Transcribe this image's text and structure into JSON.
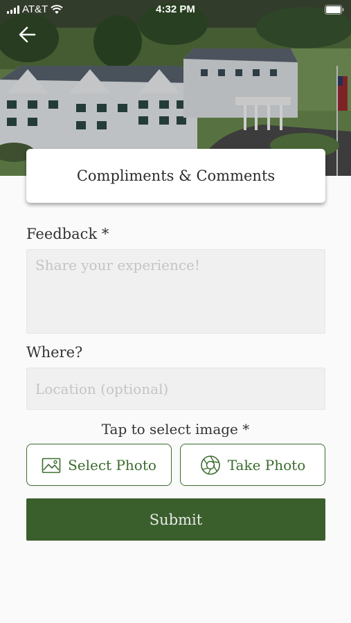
{
  "status_bar": {
    "carrier": "AT&T",
    "time": "4:32 PM"
  },
  "header": {
    "title": "Compliments & Comments"
  },
  "form": {
    "feedback_label": "Feedback *",
    "feedback_placeholder": "Share your experience!",
    "where_label": "Where?",
    "location_placeholder": "Location (optional)",
    "image_label": "Tap to select image *",
    "select_photo_label": "Select Photo",
    "take_photo_label": "Take Photo",
    "submit_label": "Submit"
  },
  "colors": {
    "accent": "#3a6b2d",
    "submit_bg": "#3a5f2c"
  }
}
